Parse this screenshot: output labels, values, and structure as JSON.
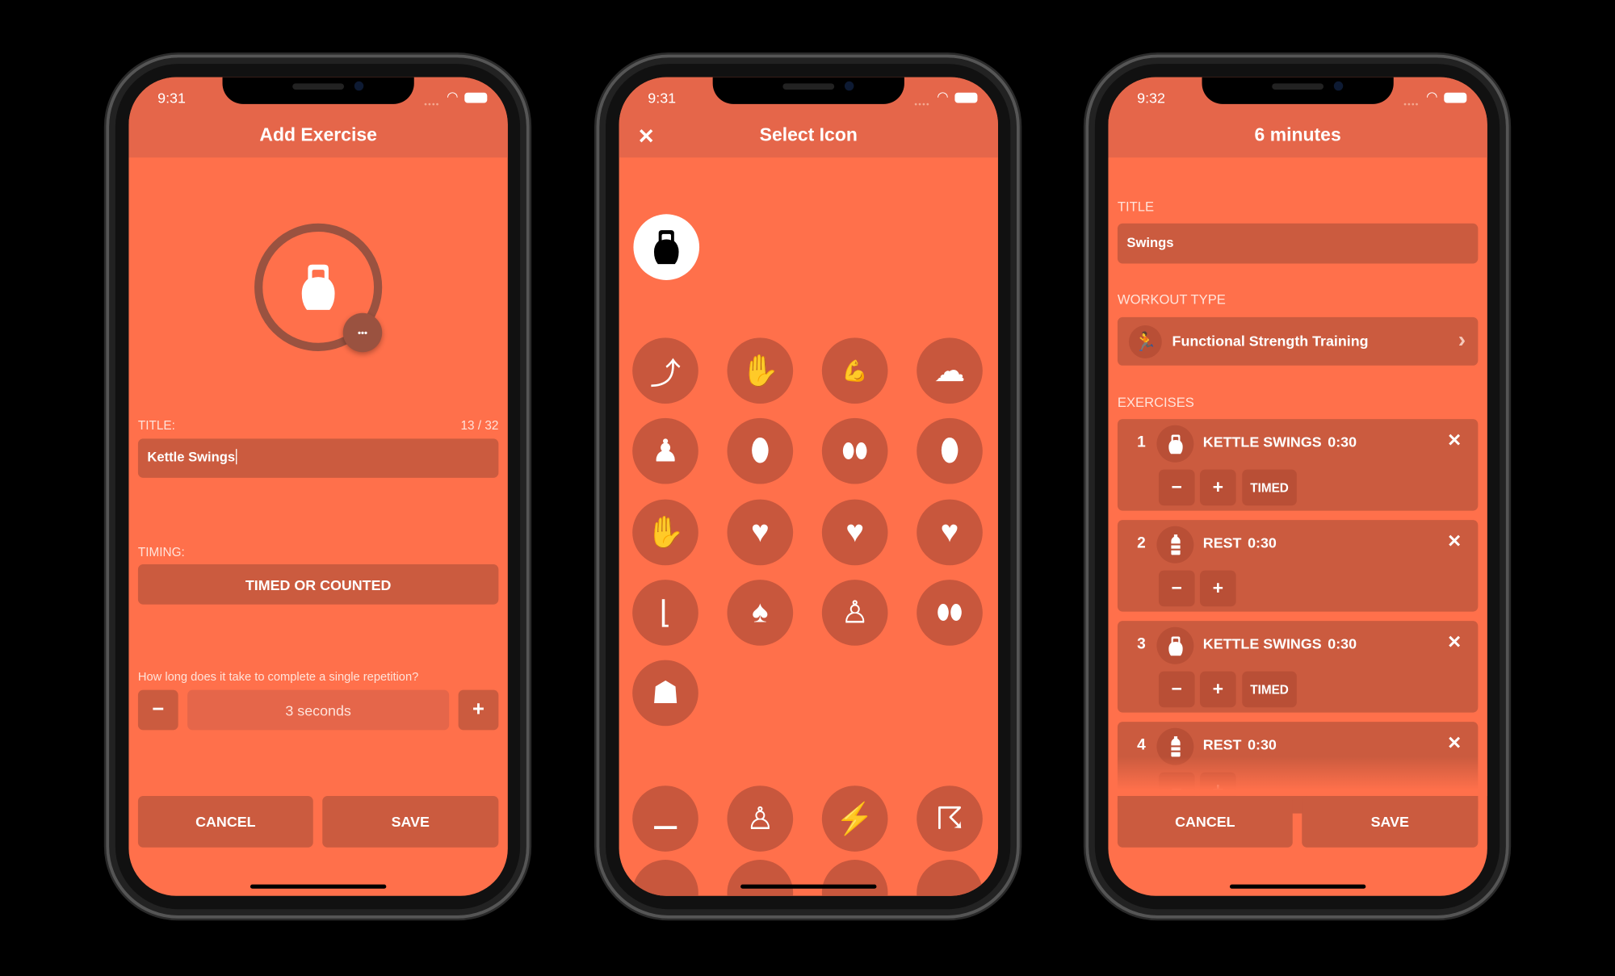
{
  "colors": {
    "background": "#FF704B",
    "header": "#E5664A",
    "field": "#CB5B3F",
    "accent_dark": "#9A5240"
  },
  "add_exercise": {
    "time": "9:31",
    "title": "Add Exercise",
    "icon": "kettlebell-icon",
    "more_label": "•••",
    "title_label": "TITLE:",
    "title_count": "13 / 32",
    "title_value": "Kettle Swings",
    "timing_label": "TIMING:",
    "timing_button": "TIMED OR COUNTED",
    "question": "How long does it take to complete a single repetition?",
    "minus": "−",
    "plus": "+",
    "duration_value": "3 seconds",
    "cancel": "CANCEL",
    "save": "SAVE"
  },
  "select_icon": {
    "time": "9:31",
    "title": "Select Icon",
    "close": "✕",
    "selected_icon": "kettlebell-icon",
    "icons": [
      {
        "name": "gymnastics-icon",
        "glyph": "⤴"
      },
      {
        "name": "clapping-hands-icon",
        "glyph": "✋"
      },
      {
        "name": "flexed-bicep-icon",
        "glyph": "💪"
      },
      {
        "name": "brain-icon",
        "glyph": "☁"
      },
      {
        "name": "body-icon",
        "glyph": "♟"
      },
      {
        "name": "foot-icon",
        "glyph": "⬮"
      },
      {
        "name": "feet-icon",
        "glyph": "⬮⬮"
      },
      {
        "name": "foot-side-icon",
        "glyph": "⬮"
      },
      {
        "name": "hand-icon",
        "glyph": "✋"
      },
      {
        "name": "heart-icon",
        "glyph": "♥"
      },
      {
        "name": "heartbeat-icon",
        "glyph": "♥"
      },
      {
        "name": "heart-brain-icon",
        "glyph": "♥"
      },
      {
        "name": "leg-icon",
        "glyph": "⌊"
      },
      {
        "name": "lungs-icon",
        "glyph": "♠"
      },
      {
        "name": "person-icon",
        "glyph": "♙"
      },
      {
        "name": "footprints-icon",
        "glyph": "⬮⬮"
      },
      {
        "name": "hair-head-icon",
        "glyph": "☗"
      }
    ],
    "icons2": [
      {
        "name": "bench-press-icon",
        "glyph": "⚊"
      },
      {
        "name": "seated-person-icon",
        "glyph": "♙"
      },
      {
        "name": "stairs-climber-icon",
        "glyph": "⚡"
      },
      {
        "name": "dance-icon",
        "glyph": "☈"
      }
    ]
  },
  "workout": {
    "time": "9:32",
    "title": "6 minutes",
    "title_label": "TITLE",
    "title_value": "Swings",
    "type_label": "WORKOUT TYPE",
    "type_value": "Functional Strength Training",
    "type_icon": "functional-strength-icon",
    "exercises_label": "EXERCISES",
    "exercises": [
      {
        "num": "1",
        "icon": "kettlebell-icon",
        "name": "KETTLE SWINGS",
        "duration": "0:30",
        "mode": "TIMED"
      },
      {
        "num": "2",
        "icon": "water-bottle-icon",
        "name": "REST",
        "duration": "0:30"
      },
      {
        "num": "3",
        "icon": "kettlebell-icon",
        "name": "KETTLE SWINGS",
        "duration": "0:30",
        "mode": "TIMED"
      },
      {
        "num": "4",
        "icon": "water-bottle-icon",
        "name": "REST",
        "duration": "0:30"
      }
    ],
    "remove": "✕",
    "minus": "−",
    "plus": "+",
    "cancel": "CANCEL",
    "save": "SAVE"
  }
}
